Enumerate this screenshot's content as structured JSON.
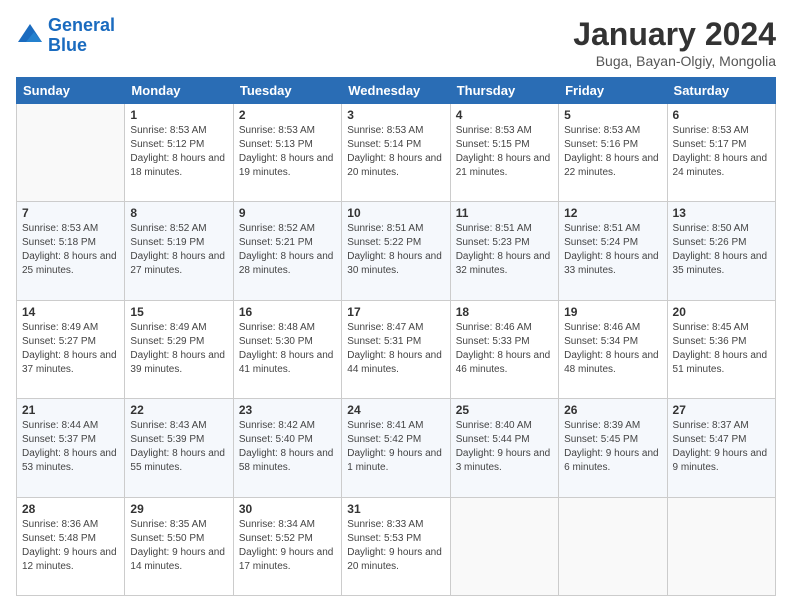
{
  "header": {
    "logo_line1": "General",
    "logo_line2": "Blue",
    "title": "January 2024",
    "subtitle": "Buga, Bayan-Olgiy, Mongolia"
  },
  "weekdays": [
    "Sunday",
    "Monday",
    "Tuesday",
    "Wednesday",
    "Thursday",
    "Friday",
    "Saturday"
  ],
  "weeks": [
    [
      {
        "num": "",
        "sunrise": "",
        "sunset": "",
        "daylight": ""
      },
      {
        "num": "1",
        "sunrise": "Sunrise: 8:53 AM",
        "sunset": "Sunset: 5:12 PM",
        "daylight": "Daylight: 8 hours and 18 minutes."
      },
      {
        "num": "2",
        "sunrise": "Sunrise: 8:53 AM",
        "sunset": "Sunset: 5:13 PM",
        "daylight": "Daylight: 8 hours and 19 minutes."
      },
      {
        "num": "3",
        "sunrise": "Sunrise: 8:53 AM",
        "sunset": "Sunset: 5:14 PM",
        "daylight": "Daylight: 8 hours and 20 minutes."
      },
      {
        "num": "4",
        "sunrise": "Sunrise: 8:53 AM",
        "sunset": "Sunset: 5:15 PM",
        "daylight": "Daylight: 8 hours and 21 minutes."
      },
      {
        "num": "5",
        "sunrise": "Sunrise: 8:53 AM",
        "sunset": "Sunset: 5:16 PM",
        "daylight": "Daylight: 8 hours and 22 minutes."
      },
      {
        "num": "6",
        "sunrise": "Sunrise: 8:53 AM",
        "sunset": "Sunset: 5:17 PM",
        "daylight": "Daylight: 8 hours and 24 minutes."
      }
    ],
    [
      {
        "num": "7",
        "sunrise": "Sunrise: 8:53 AM",
        "sunset": "Sunset: 5:18 PM",
        "daylight": "Daylight: 8 hours and 25 minutes."
      },
      {
        "num": "8",
        "sunrise": "Sunrise: 8:52 AM",
        "sunset": "Sunset: 5:19 PM",
        "daylight": "Daylight: 8 hours and 27 minutes."
      },
      {
        "num": "9",
        "sunrise": "Sunrise: 8:52 AM",
        "sunset": "Sunset: 5:21 PM",
        "daylight": "Daylight: 8 hours and 28 minutes."
      },
      {
        "num": "10",
        "sunrise": "Sunrise: 8:51 AM",
        "sunset": "Sunset: 5:22 PM",
        "daylight": "Daylight: 8 hours and 30 minutes."
      },
      {
        "num": "11",
        "sunrise": "Sunrise: 8:51 AM",
        "sunset": "Sunset: 5:23 PM",
        "daylight": "Daylight: 8 hours and 32 minutes."
      },
      {
        "num": "12",
        "sunrise": "Sunrise: 8:51 AM",
        "sunset": "Sunset: 5:24 PM",
        "daylight": "Daylight: 8 hours and 33 minutes."
      },
      {
        "num": "13",
        "sunrise": "Sunrise: 8:50 AM",
        "sunset": "Sunset: 5:26 PM",
        "daylight": "Daylight: 8 hours and 35 minutes."
      }
    ],
    [
      {
        "num": "14",
        "sunrise": "Sunrise: 8:49 AM",
        "sunset": "Sunset: 5:27 PM",
        "daylight": "Daylight: 8 hours and 37 minutes."
      },
      {
        "num": "15",
        "sunrise": "Sunrise: 8:49 AM",
        "sunset": "Sunset: 5:29 PM",
        "daylight": "Daylight: 8 hours and 39 minutes."
      },
      {
        "num": "16",
        "sunrise": "Sunrise: 8:48 AM",
        "sunset": "Sunset: 5:30 PM",
        "daylight": "Daylight: 8 hours and 41 minutes."
      },
      {
        "num": "17",
        "sunrise": "Sunrise: 8:47 AM",
        "sunset": "Sunset: 5:31 PM",
        "daylight": "Daylight: 8 hours and 44 minutes."
      },
      {
        "num": "18",
        "sunrise": "Sunrise: 8:46 AM",
        "sunset": "Sunset: 5:33 PM",
        "daylight": "Daylight: 8 hours and 46 minutes."
      },
      {
        "num": "19",
        "sunrise": "Sunrise: 8:46 AM",
        "sunset": "Sunset: 5:34 PM",
        "daylight": "Daylight: 8 hours and 48 minutes."
      },
      {
        "num": "20",
        "sunrise": "Sunrise: 8:45 AM",
        "sunset": "Sunset: 5:36 PM",
        "daylight": "Daylight: 8 hours and 51 minutes."
      }
    ],
    [
      {
        "num": "21",
        "sunrise": "Sunrise: 8:44 AM",
        "sunset": "Sunset: 5:37 PM",
        "daylight": "Daylight: 8 hours and 53 minutes."
      },
      {
        "num": "22",
        "sunrise": "Sunrise: 8:43 AM",
        "sunset": "Sunset: 5:39 PM",
        "daylight": "Daylight: 8 hours and 55 minutes."
      },
      {
        "num": "23",
        "sunrise": "Sunrise: 8:42 AM",
        "sunset": "Sunset: 5:40 PM",
        "daylight": "Daylight: 8 hours and 58 minutes."
      },
      {
        "num": "24",
        "sunrise": "Sunrise: 8:41 AM",
        "sunset": "Sunset: 5:42 PM",
        "daylight": "Daylight: 9 hours and 1 minute."
      },
      {
        "num": "25",
        "sunrise": "Sunrise: 8:40 AM",
        "sunset": "Sunset: 5:44 PM",
        "daylight": "Daylight: 9 hours and 3 minutes."
      },
      {
        "num": "26",
        "sunrise": "Sunrise: 8:39 AM",
        "sunset": "Sunset: 5:45 PM",
        "daylight": "Daylight: 9 hours and 6 minutes."
      },
      {
        "num": "27",
        "sunrise": "Sunrise: 8:37 AM",
        "sunset": "Sunset: 5:47 PM",
        "daylight": "Daylight: 9 hours and 9 minutes."
      }
    ],
    [
      {
        "num": "28",
        "sunrise": "Sunrise: 8:36 AM",
        "sunset": "Sunset: 5:48 PM",
        "daylight": "Daylight: 9 hours and 12 minutes."
      },
      {
        "num": "29",
        "sunrise": "Sunrise: 8:35 AM",
        "sunset": "Sunset: 5:50 PM",
        "daylight": "Daylight: 9 hours and 14 minutes."
      },
      {
        "num": "30",
        "sunrise": "Sunrise: 8:34 AM",
        "sunset": "Sunset: 5:52 PM",
        "daylight": "Daylight: 9 hours and 17 minutes."
      },
      {
        "num": "31",
        "sunrise": "Sunrise: 8:33 AM",
        "sunset": "Sunset: 5:53 PM",
        "daylight": "Daylight: 9 hours and 20 minutes."
      },
      {
        "num": "",
        "sunrise": "",
        "sunset": "",
        "daylight": ""
      },
      {
        "num": "",
        "sunrise": "",
        "sunset": "",
        "daylight": ""
      },
      {
        "num": "",
        "sunrise": "",
        "sunset": "",
        "daylight": ""
      }
    ]
  ]
}
